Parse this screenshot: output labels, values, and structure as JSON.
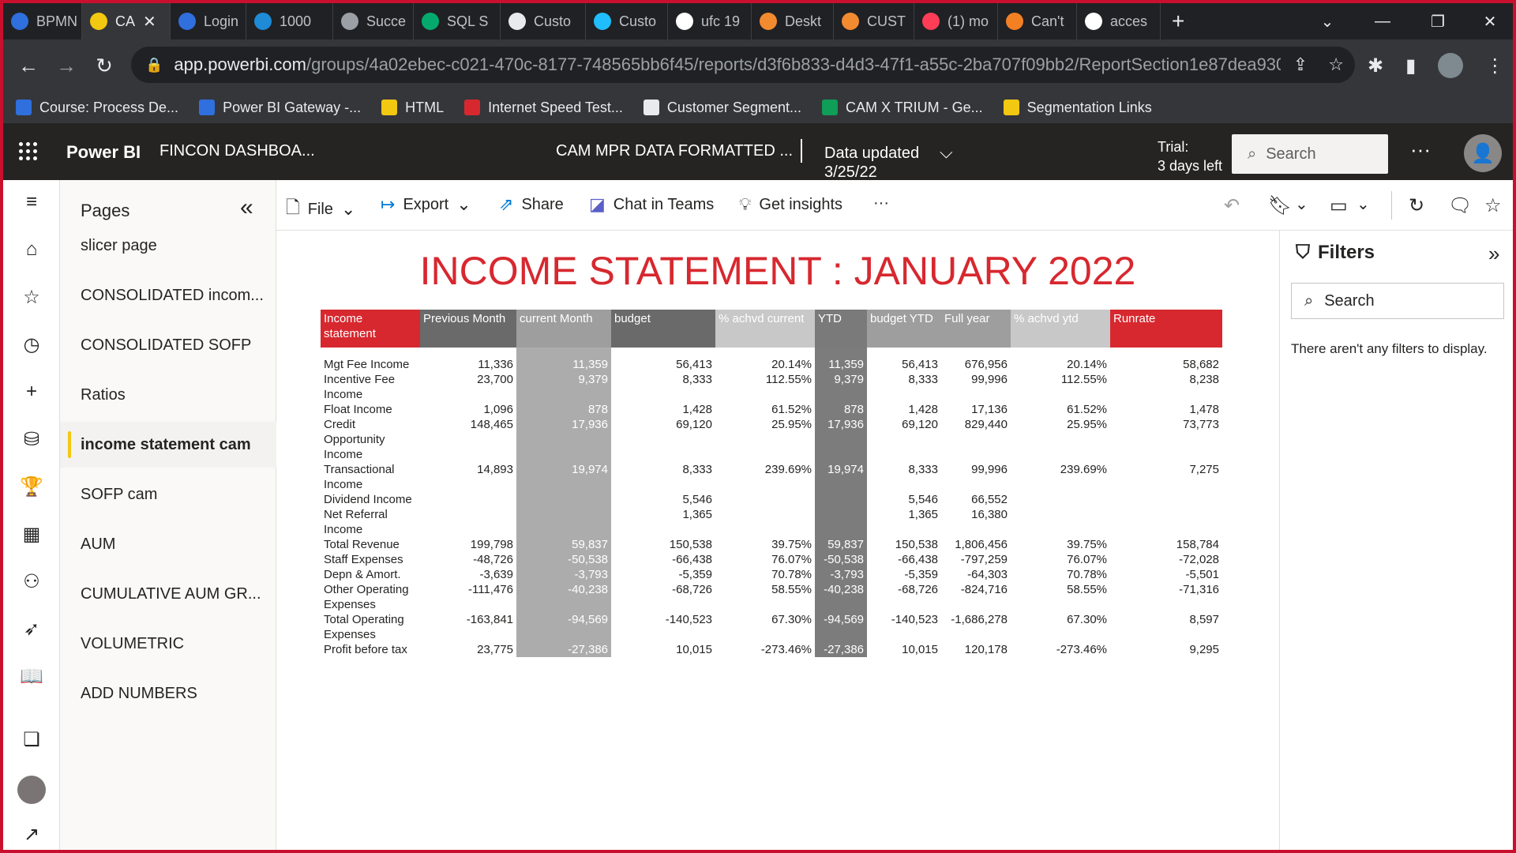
{
  "browser": {
    "tabs": [
      {
        "label": "BPMN",
        "icon": "powerbi-icon",
        "color": "#2f6fde"
      },
      {
        "label": "CA",
        "icon": "powerbi-yellow-icon",
        "color": "#f2c811",
        "active": true
      },
      {
        "label": "Login",
        "icon": "login-icon",
        "color": "#2f6fde"
      },
      {
        "label": "1000",
        "icon": "onedrive-icon",
        "color": "#1f8ad6"
      },
      {
        "label": "Succe",
        "icon": "globe-icon",
        "color": "#9aa0a6"
      },
      {
        "label": "SQL S",
        "icon": "w3schools-icon",
        "color": "#04aa6d"
      },
      {
        "label": "Custo",
        "icon": "github-icon",
        "color": "#e8eaed"
      },
      {
        "label": "Custo",
        "icon": "kaggle-icon",
        "color": "#20beff"
      },
      {
        "label": "ufc 19",
        "icon": "google-icon",
        "color": "#ffffff"
      },
      {
        "label": "Deskt",
        "icon": "desktop-icon",
        "color": "#f28b30"
      },
      {
        "label": "CUST",
        "icon": "folder-icon",
        "color": "#f28b30"
      },
      {
        "label": "(1) mo",
        "icon": "monday-icon",
        "color": "#ff3d57"
      },
      {
        "label": "Can't",
        "icon": "stackoverflow-icon",
        "color": "#f48024"
      },
      {
        "label": "acces",
        "icon": "google-icon",
        "color": "#ffffff"
      }
    ],
    "url_host": "app.powerbi.com",
    "url_path": "/groups/4a02ebec-c021-470c-8177-748565bb6f45/reports/d3f6b833-d4d3-47f1-a55c-2ba707f09bb2/ReportSection1e87dea93044...",
    "bookmarks": [
      {
        "label": "Course: Process De...",
        "color": "#2f6fde"
      },
      {
        "label": "Power BI Gateway -...",
        "color": "#2f6fde"
      },
      {
        "label": "HTML",
        "color": "#f2c811"
      },
      {
        "label": "Internet Speed Test...",
        "color": "#d7282f"
      },
      {
        "label": "Customer Segment...",
        "color": "#e8eaed"
      },
      {
        "label": "CAM X TRIUM - Ge...",
        "color": "#0f9d58"
      },
      {
        "label": "Segmentation Links",
        "color": "#f2c811"
      }
    ]
  },
  "header": {
    "brand": "Power BI",
    "workspace": "FINCON DASHBOA...",
    "report": "CAM MPR DATA FORMATTED ...",
    "updated_label": "Data updated",
    "updated_date": "3/25/22",
    "trial_line1": "Trial:",
    "trial_line2": "3 days left",
    "search_placeholder": "Search"
  },
  "pages": {
    "title": "Pages",
    "items": [
      {
        "label": "slicer page"
      },
      {
        "label": "CONSOLIDATED incom..."
      },
      {
        "label": "CONSOLIDATED SOFP"
      },
      {
        "label": "Ratios"
      },
      {
        "label": "income statement cam",
        "active": true
      },
      {
        "label": "SOFP cam"
      },
      {
        "label": "AUM"
      },
      {
        "label": "CUMULATIVE AUM GR..."
      },
      {
        "label": "VOLUMETRIC"
      },
      {
        "label": "ADD NUMBERS"
      }
    ]
  },
  "toolbar": {
    "file": "File",
    "export": "Export",
    "share": "Share",
    "chat": "Chat in Teams",
    "insights": "Get insights",
    "more": "···"
  },
  "report": {
    "title": "INCOME STATEMENT : JANUARY 2022",
    "columns": [
      "Income statement",
      "Previous Month",
      "current Month",
      "budget",
      "% achvd current",
      "YTD",
      "budget YTD",
      "Full year",
      "% achvd ytd",
      "Runrate"
    ],
    "rows": [
      [
        "Mgt Fee Income",
        "11,336",
        "11,359",
        "56,413",
        "20.14%",
        "11,359",
        "56,413",
        "676,956",
        "20.14%",
        "58,682"
      ],
      [
        "Incentive Fee Income",
        "23,700",
        "9,379",
        "8,333",
        "112.55%",
        "9,379",
        "8,333",
        "99,996",
        "112.55%",
        "8,238"
      ],
      [
        "Float Income",
        "1,096",
        "878",
        "1,428",
        "61.52%",
        "878",
        "1,428",
        "17,136",
        "61.52%",
        "1,478"
      ],
      [
        "Credit Opportunity Income",
        "148,465",
        "17,936",
        "69,120",
        "25.95%",
        "17,936",
        "69,120",
        "829,440",
        "25.95%",
        "73,773"
      ],
      [
        "Transactional Income",
        "14,893",
        "19,974",
        "8,333",
        "239.69%",
        "19,974",
        "8,333",
        "99,996",
        "239.69%",
        "7,275"
      ],
      [
        "Dividend Income",
        "",
        "",
        "5,546",
        "",
        "",
        "5,546",
        "66,552",
        "",
        ""
      ],
      [
        "Net Referral Income",
        "",
        "",
        "1,365",
        "",
        "",
        "1,365",
        "16,380",
        "",
        ""
      ],
      [
        "Total Revenue",
        "199,798",
        "59,837",
        "150,538",
        "39.75%",
        "59,837",
        "150,538",
        "1,806,456",
        "39.75%",
        "158,784"
      ],
      [
        "Staff Expenses",
        "-48,726",
        "-50,538",
        "-66,438",
        "76.07%",
        "-50,538",
        "-66,438",
        "-797,259",
        "76.07%",
        "-72,028"
      ],
      [
        "Depn & Amort.",
        "-3,639",
        "-3,793",
        "-5,359",
        "70.78%",
        "-3,793",
        "-5,359",
        "-64,303",
        "70.78%",
        "-5,501"
      ],
      [
        "Other Operating Expenses",
        "-111,476",
        "-40,238",
        "-68,726",
        "58.55%",
        "-40,238",
        "-68,726",
        "-824,716",
        "58.55%",
        "-71,316"
      ],
      [
        "Total Operating Expenses",
        "-163,841",
        "-94,569",
        "-140,523",
        "67.30%",
        "-94,569",
        "-140,523",
        "-1,686,278",
        "67.30%",
        "8,597"
      ],
      [
        "Profit before tax",
        "23,775",
        "-27,386",
        "10,015",
        "-273.46%",
        "-27,386",
        "10,015",
        "120,178",
        "-273.46%",
        "9,295"
      ]
    ]
  },
  "filters": {
    "title": "Filters",
    "search_placeholder": "Search",
    "empty_message": "There aren't any filters to display."
  },
  "colors": {
    "frame": "#c8102e",
    "title_red": "#d7282f",
    "header_bg": "#252423",
    "active_page_accent": "#f2c811"
  }
}
